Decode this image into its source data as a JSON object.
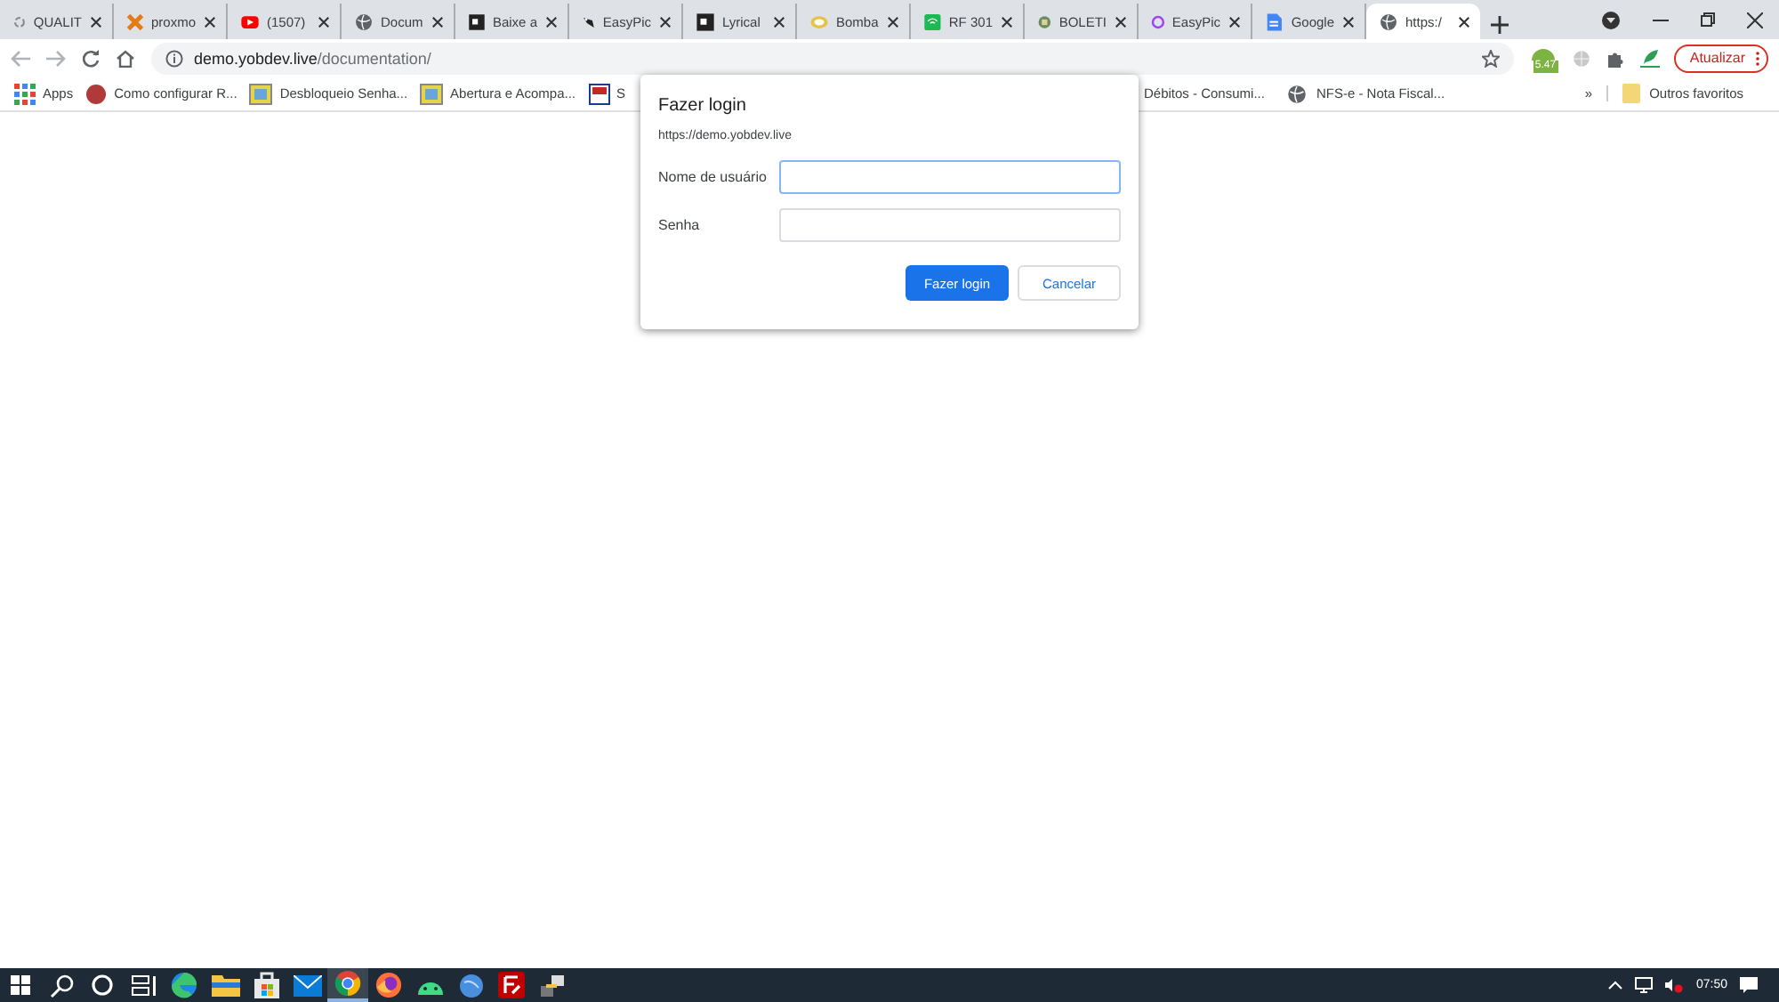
{
  "tabs": [
    {
      "title": "QUALIT",
      "selected": false
    },
    {
      "title": "proxmo",
      "selected": false
    },
    {
      "title": "(1507)",
      "selected": false
    },
    {
      "title": "Docum",
      "selected": false
    },
    {
      "title": "Baixe a",
      "selected": false
    },
    {
      "title": "EasyPic",
      "selected": false
    },
    {
      "title": "Lyrical",
      "selected": false
    },
    {
      "title": "Bomba",
      "selected": false
    },
    {
      "title": "RF 301",
      "selected": false
    },
    {
      "title": "BOLETI",
      "selected": false
    },
    {
      "title": "EasyPic",
      "selected": false
    },
    {
      "title": "Google",
      "selected": false
    },
    {
      "title": "https:/",
      "selected": true
    }
  ],
  "address": {
    "host": "demo.yobdev.live",
    "path": "/documentation/"
  },
  "extension_badge": "5.47",
  "update_button": "Atualizar",
  "bookmarks": [
    "Apps",
    "Como configurar R...",
    "Desbloqueio Senha...",
    "Abertura e Acompa...",
    "S",
    "Débitos - Consumi...",
    "NFS-e - Nota Fiscal..."
  ],
  "bookmarks_more": "»",
  "other_bookmarks": "Outros favoritos",
  "dialog": {
    "title": "Fazer login",
    "origin": "https://demo.yobdev.live",
    "fields": [
      {
        "label": "Nome de usuário",
        "focused": true
      },
      {
        "label": "Senha",
        "focused": false
      }
    ],
    "ok": "Fazer login",
    "cancel": "Cancelar"
  },
  "taskbar": [
    {
      "selected": false
    },
    {
      "selected": false
    },
    {
      "selected": false
    },
    {
      "selected": false
    },
    {
      "selected": false
    },
    {
      "selected": false
    },
    {
      "selected": false
    },
    {
      "selected": true
    },
    {
      "selected": false
    },
    {
      "selected": false
    },
    {
      "selected": false
    },
    {
      "selected": false
    },
    {
      "selected": false
    }
  ],
  "clock": "07:50"
}
